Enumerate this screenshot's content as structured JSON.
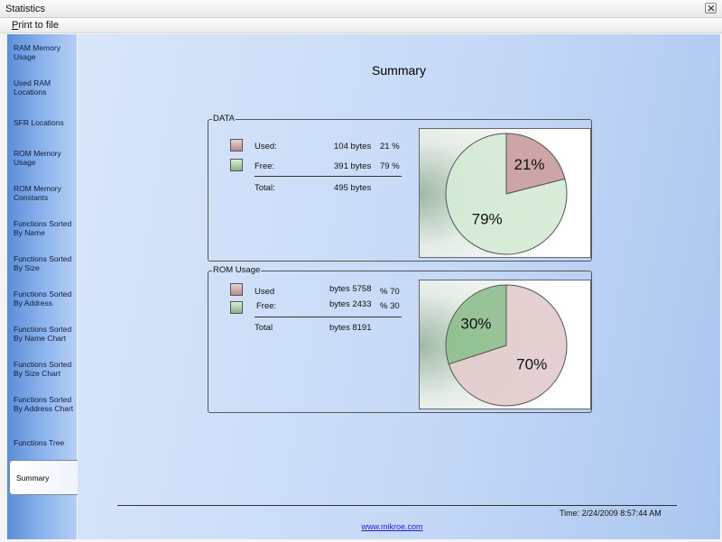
{
  "window": {
    "title": "Statistics"
  },
  "menu": {
    "print_prefix": "P",
    "print_rest": "rint to file"
  },
  "sidebar": {
    "items": [
      {
        "label": "RAM Memory\nUsage"
      },
      {
        "label": "Used RAM\nLocations"
      },
      {
        "label": "SFR Locations"
      },
      {
        "label": "ROM Memory\nUsage"
      },
      {
        "label": "ROM Memory\nConstants"
      },
      {
        "label": "Functions Sorted\nBy  Name"
      },
      {
        "label": "Functions Sorted\nBy Size"
      },
      {
        "label": "Functions Sorted\nBy Address"
      },
      {
        "label": "Functions Sorted\nBy Name Chart"
      },
      {
        "label": "Functions Sorted\nBy Size Chart"
      },
      {
        "label": "Functions Sorted\nBy Address Chart"
      },
      {
        "label": "Functions Tree"
      },
      {
        "label": "Summary"
      }
    ]
  },
  "main": {
    "title": "Summary",
    "footer": {
      "time": "Time: 2/24/2009 8:57:44 AM",
      "url": "www.mikroe.com"
    }
  },
  "data_group": {
    "legend": "DATA",
    "used_label": "Used:",
    "used_value": "104 bytes",
    "used_percent": "21 %",
    "free_label": "Free:",
    "free_value": "391 bytes",
    "free_percent": "79 %",
    "total_label": "Total:",
    "total_value": "495 bytes"
  },
  "rom_group": {
    "legend": "ROM Usage",
    "used_label": "Used",
    "used_value": "bytes 5758",
    "used_percent": "% 70",
    "free_label": "Free:",
    "free_value": "bytes 2433",
    "free_percent": "% 30",
    "total_label": "Total",
    "total_value": "bytes 8191"
  },
  "chart_data": [
    {
      "type": "pie",
      "slices": [
        {
          "name": "Used",
          "value": 21,
          "label": "21%",
          "color": "#c99d9d"
        },
        {
          "name": "Free",
          "value": 79,
          "label": "79%",
          "color": "#d5ead5"
        }
      ]
    },
    {
      "type": "pie",
      "slices": [
        {
          "name": "Used",
          "value": 70,
          "label": "70%",
          "color": "#e2cccc"
        },
        {
          "name": "Free",
          "value": 30,
          "label": "30%",
          "color": "#8fbf8f"
        }
      ]
    }
  ],
  "colors": {
    "sidebar_start": "#5b8ed8",
    "panel_bg": "#c4d8f6",
    "link": "#1a23d6"
  }
}
